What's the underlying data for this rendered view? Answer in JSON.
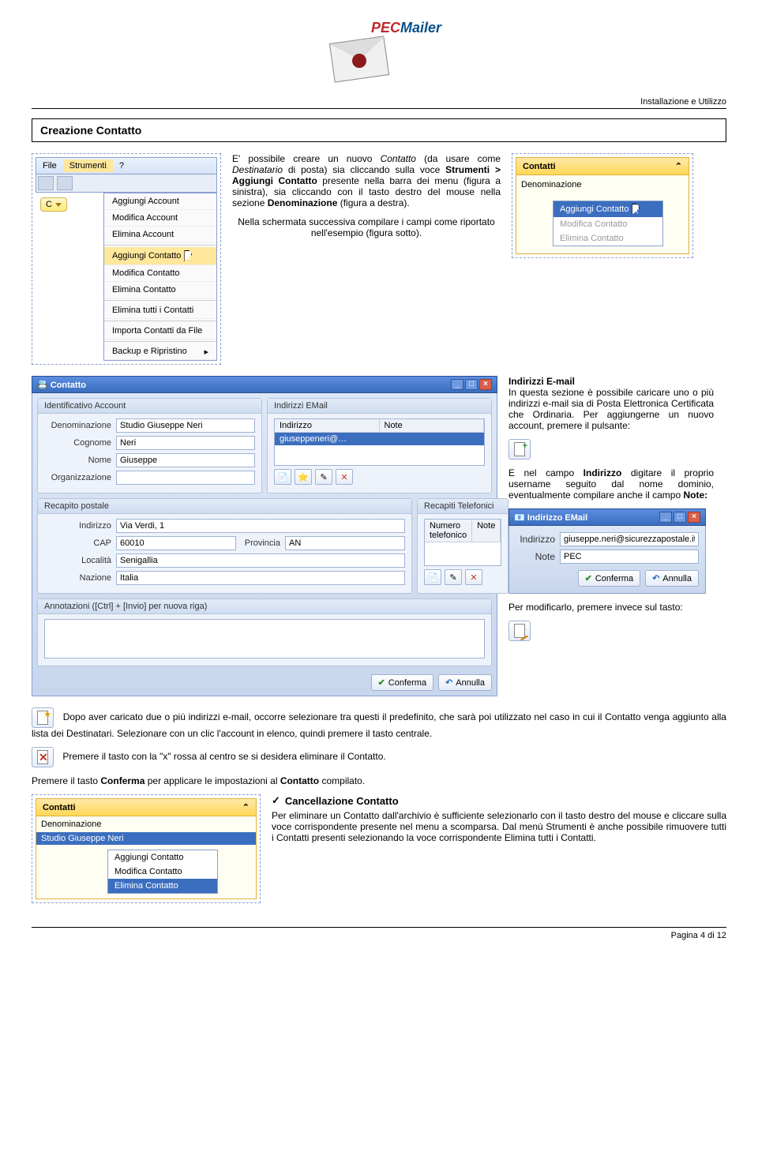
{
  "header": {
    "right": "Installazione e Utilizzo"
  },
  "logo": {
    "text_pec": "PEC",
    "text_mailer": "Mailer"
  },
  "section_title": "Creazione Contatto",
  "intro_block": {
    "p1_a": "E' possibile creare un nuovo ",
    "p1_b": " (da usare come ",
    "p1_c": " di posta) sia cliccando sulla voce ",
    "p1_d": " presente nella barra dei menu (figura a sinistra), sia cliccando con il tasto destro del mouse nella sezione ",
    "p1_e": " (figura a destra).",
    "contatto": "Contatto",
    "destinatario": "Destinatario",
    "strumenti": "Strumenti > Aggiungi Contatto",
    "denominazione": "Denominazione",
    "p2": "Nella schermata successiva compilare i campi come riportato nell'esempio (figura sotto)."
  },
  "menu1": {
    "menubar": [
      "File",
      "Strumenti",
      "?"
    ],
    "account_chip": "C",
    "items": [
      "Aggiungi Account",
      "Modifica Account",
      "Elimina Account",
      "Aggiungi Contatto",
      "Modifica Contatto",
      "Elimina Contatto",
      "Elimina tutti i Contatti",
      "Importa Contatti da File",
      "Backup e Ripristino"
    ]
  },
  "contatti_panel": {
    "title": "Contatti",
    "field": "Denominazione",
    "ctx": [
      "Aggiungi Contatto",
      "Modifica Contatto",
      "Elimina Contatto"
    ]
  },
  "contatto_form": {
    "title": "Contatto",
    "groups": {
      "identificativo": {
        "header": "Identificativo Account",
        "denominazione_lbl": "Denominazione",
        "denominazione_val": "Studio Giuseppe Neri",
        "cognome_lbl": "Cognome",
        "cognome_val": "Neri",
        "nome_lbl": "Nome",
        "nome_val": "Giuseppe",
        "org_lbl": "Organizzazione",
        "org_val": ""
      },
      "indirizzi": {
        "header": "Indirizzi EMail",
        "col1": "Indirizzo",
        "col2": "Note",
        "row_val": "giuseppeneri@…"
      },
      "recapito": {
        "header": "Recapito postale",
        "indirizzo_lbl": "Indirizzo",
        "indirizzo_val": "Via Verdi, 1",
        "cap_lbl": "CAP",
        "cap_val": "60010",
        "provincia_lbl": "Provincia",
        "provincia_val": "AN",
        "localita_lbl": "Località",
        "localita_val": "Senigallia",
        "nazione_lbl": "Nazione",
        "nazione_val": "Italia"
      },
      "telefonici": {
        "header": "Recapiti Telefonici",
        "col1": "Numero telefonico",
        "col2": "Note"
      },
      "annotazioni": {
        "header": "Annotazioni ([Ctrl] + [Invio] per nuova riga)"
      }
    },
    "buttons": {
      "conferma": "Conferma",
      "annulla": "Annulla"
    }
  },
  "right_text": {
    "h1": "Indirizzi E-mail",
    "p1": "In questa sezione è possibile caricare uno o più indirizzi e-mail sia di Posta Elettronica Certificata che Ordinaria. Per aggiungerne un nuovo account, premere il pulsante:",
    "p2a": "E nel campo ",
    "p2_bold": "Indirizzo",
    "p2b": " digitare il proprio username seguito dal nome dominio, eventualmente compilare anche il campo ",
    "p2_bold2": "Note:",
    "p3": "Per modificarlo, premere invece sul tasto:"
  },
  "email_dlg": {
    "title": "Indirizzo EMail",
    "indirizzo_lbl": "Indirizzo",
    "indirizzo_val": "giuseppe.neri@sicurezzapostale.it",
    "note_lbl": "Note",
    "note_val": "PEC",
    "conferma": "Conferma",
    "annulla": "Annulla"
  },
  "lower_text": {
    "p1": "Dopo aver caricato due o più indirizzi e-mail, occorre selezionare tra questi il predefinito, che sarà poi utilizzato nel caso in cui il Contatto venga aggiunto alla lista dei Destinatari. Selezionare con un clic l'account in elenco, quindi premere il tasto centrale.",
    "p2": "Premere il tasto con la \"x\" rossa al centro se si desidera eliminare il Contatto.",
    "p3a": "Premere il tasto ",
    "p3b": "Conferma",
    "p3c": " per applicare le impostazioni al ",
    "p3d": "Contatto",
    "p3e": " compilato."
  },
  "cancel_section": {
    "title": "Cancellazione Contatto",
    "body": "Per eliminare un Contatto dall'archivio è sufficiente selezionarlo con il tasto destro del mouse e cliccare sulla voce corrispondente presente nel menu a scomparsa. Dal menù Strumenti è anche possibile rimuovere tutti i Contatti presenti selezionando la voce corrispondente Elimina tutti i Contatti."
  },
  "bottom_panel": {
    "title": "Contatti",
    "field": "Denominazione",
    "selected": "Studio Giuseppe Neri",
    "ctx": [
      "Aggiungi Contatto",
      "Modifica Contatto",
      "Elimina Contatto"
    ]
  },
  "footer": "Pagina 4 di 12"
}
